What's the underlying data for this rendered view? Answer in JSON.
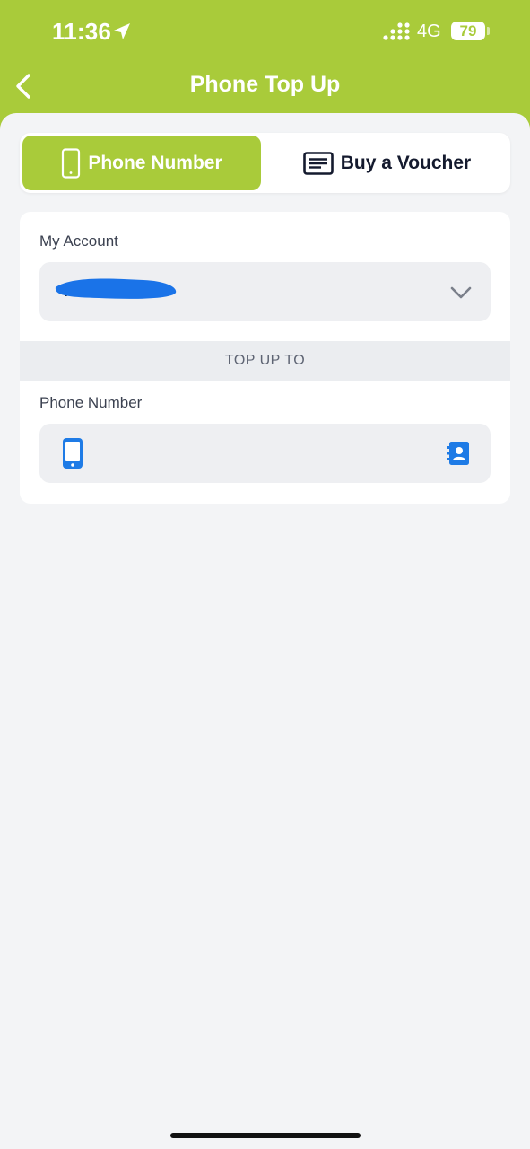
{
  "status_bar": {
    "time": "11:36",
    "network": "4G",
    "battery": "79",
    "icons": [
      "location-arrow-icon",
      "signal-icon",
      "battery-icon"
    ]
  },
  "nav": {
    "title": "Phone Top Up",
    "back_icon": "chevron-left-icon"
  },
  "tabs": [
    {
      "label": "Phone Number",
      "icon": "mobile-phone-icon",
      "selected": true
    },
    {
      "label": "Buy a Voucher",
      "icon": "voucher-icon",
      "selected": false
    }
  ],
  "account": {
    "label": "My Account",
    "value": "To",
    "redacted": true
  },
  "section": {
    "title": "TOP UP TO"
  },
  "phone": {
    "label": "Phone Number",
    "value": "",
    "placeholder": ""
  },
  "colors": {
    "brand": "#a9cb3a",
    "background": "#f3f4f6",
    "field": "#eeeff2",
    "icon_blue": "#1e7be6",
    "redaction_blue": "#1a73e8"
  }
}
